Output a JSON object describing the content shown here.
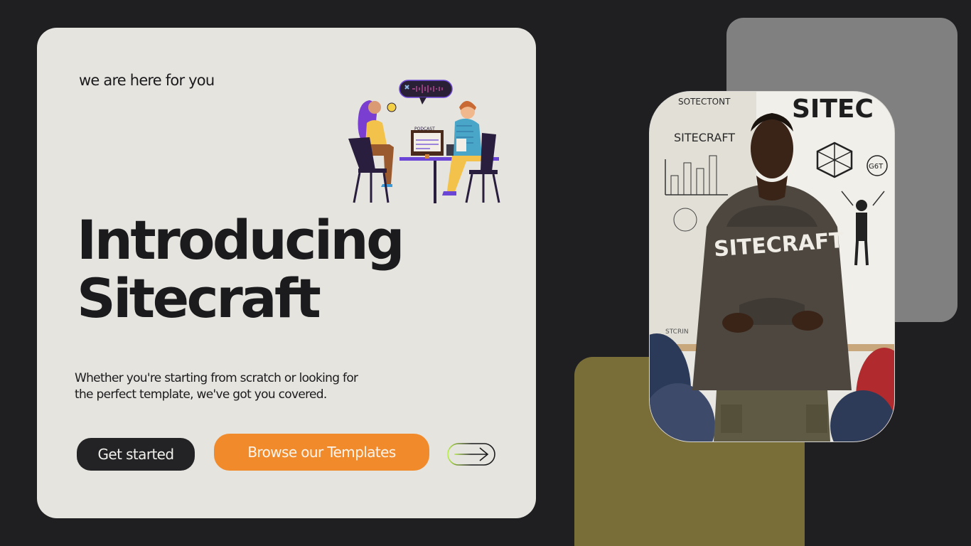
{
  "hero": {
    "tagline": "we are here for you",
    "title_line1": "Introducing",
    "title_line2": "Sitecraft",
    "description": "Whether you're starting from scratch or looking for the perfect template, we've got you covered."
  },
  "actions": {
    "primary_label": "Get started",
    "secondary_label": "Browse our Templates"
  },
  "illustration": {
    "icon": "podcast-recording-illustration",
    "screen_label": "PODCAST"
  },
  "photo": {
    "hoodie_text": "SITECRAFT",
    "board_heading": "SITEC",
    "board_label": "SITECRAFT",
    "board_note": "SOTECTONT",
    "board_tag": "G6T",
    "board_footer": "STCRIN"
  },
  "colors": {
    "background": "#1f1f22",
    "card": "#e6e4df",
    "accent_orange": "#f08a2a",
    "dark_button": "#232325",
    "gray_block": "#808080",
    "olive_block": "#7a6e38"
  }
}
